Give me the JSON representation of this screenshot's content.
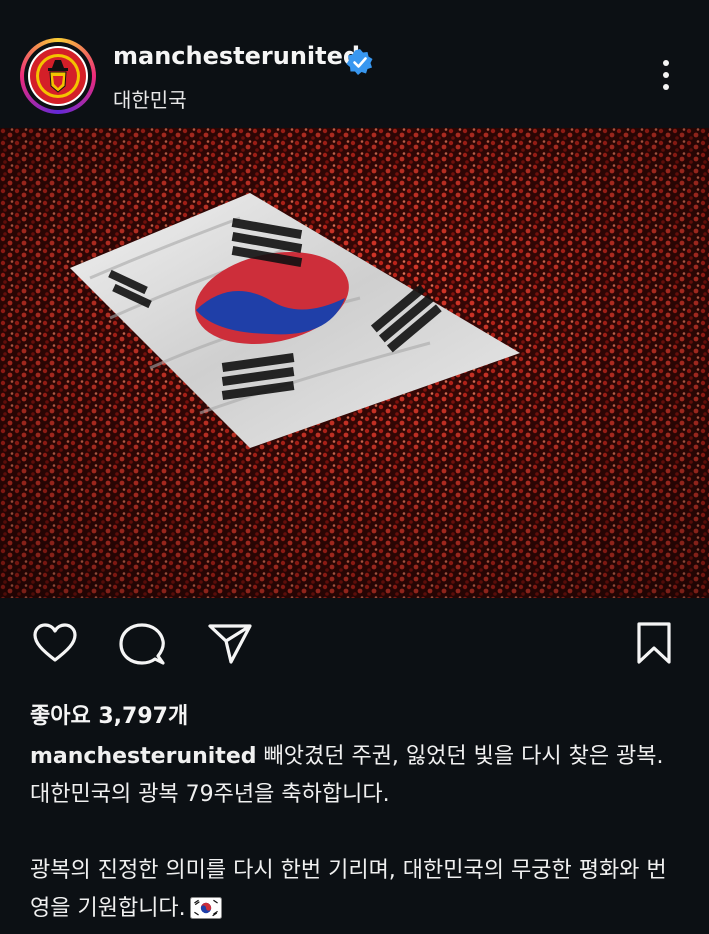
{
  "post": {
    "username": "manchesterunited",
    "location": "대한민국",
    "likes_text": "좋아요 3,797개",
    "caption_line1": "빼앗겼던 주권, 잃었던 빛을 다시 찾은 광복. 대한민국의 광복 79주년을 축하합니다.",
    "caption_para2": "광복의 진정한 의미를 다시 한번 기리며, 대한민국의 무궁한 평화와 번영을 기원합니다."
  },
  "icons": {
    "verified": "verified-badge-icon",
    "more": "more-options-icon",
    "like": "heart-icon",
    "comment": "comment-icon",
    "share": "send-icon",
    "save": "bookmark-icon",
    "flag": "south-korea-flag-icon"
  },
  "colors": {
    "background": "#0c1014",
    "verified_blue": "#3897f0",
    "text": "#f5f5f5"
  }
}
